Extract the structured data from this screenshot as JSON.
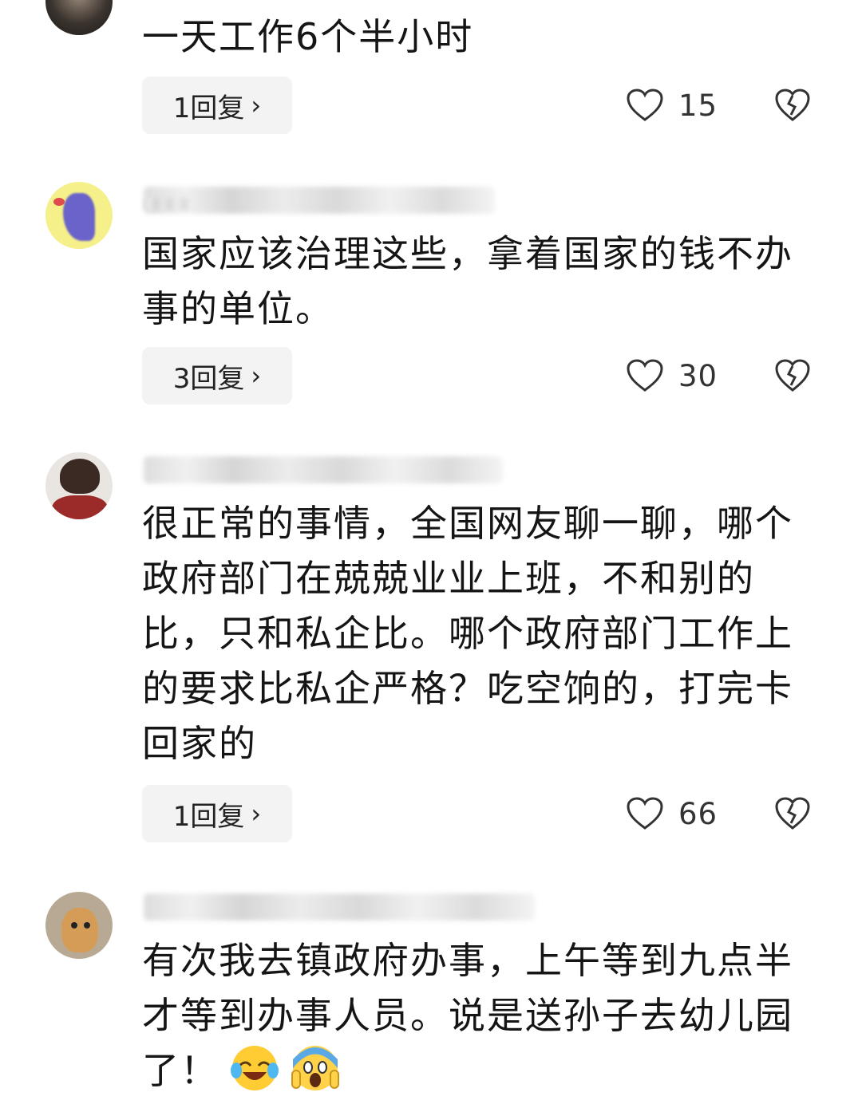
{
  "comments": [
    {
      "text": "一天工作6个半小时",
      "reply_label": "1回复",
      "likes": "15"
    },
    {
      "text": "国家应该治理这些，拿着国家的钱不办事的单位。",
      "reply_label": "3回复",
      "likes": "30"
    },
    {
      "text": "很正常的事情，全国网友聊一聊，哪个政府部门在兢兢业业上班，不和别的比，只和私企比。哪个政府部门工作上的要求比私企严格？吃空饷的，打完卡回家的",
      "reply_label": "1回复",
      "likes": "66"
    },
    {
      "text": "有次我去镇政府办事，上午等到九点半才等到办事人员。说是送孙子去幼儿园了！",
      "emojis": [
        "laughing-crying-emoji",
        "screaming-emoji"
      ]
    }
  ],
  "icons": {
    "like": "heart-outline-icon",
    "dislike": "broken-heart-icon",
    "chevron": "›"
  },
  "colors": {
    "reply_bg": "#f3f3f3",
    "text": "#151515",
    "icon_stroke": "#333333"
  }
}
